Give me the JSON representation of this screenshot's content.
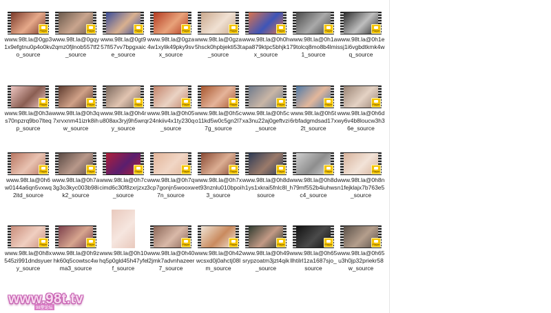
{
  "files": [
    {
      "name": "www.98t.la@0gp31x9efgtnu0p4o0kvo_source",
      "colors": [
        "#7a3a2a",
        "#e6a98a"
      ]
    },
    {
      "name": "www.98t.la@0gqy2qmz0fjlnob557tf2_source",
      "colors": [
        "#6b5a4d",
        "#c9a58e"
      ]
    },
    {
      "name": "www.98t.la@0gt957fi57vv7bpgxaice_source",
      "colors": [
        "#3a4d9a",
        "#d9b08f"
      ]
    },
    {
      "name": "www.98t.la@0gza4w1xylik49pky9svx_source",
      "colors": [
        "#b43b21",
        "#e8a27a"
      ]
    },
    {
      "name": "www.98t.la@0gza5hsck0hpbjekti53t_source",
      "colors": [
        "#caa98e",
        "#f0e1d3"
      ]
    },
    {
      "name": "www.98t.la@0h0hapa879ktpc5bhjk1x_source",
      "colors": [
        "#d9734e",
        "#3e55b8"
      ]
    },
    {
      "name": "www.98t.la@0h1a79tolcq8mo8b4lmi1_source",
      "colors": [
        "#4b4b4b",
        "#a9a9a9"
      ]
    },
    {
      "name": "www.98t.la@0h1essj1i6vgbdtkmk4wq_source",
      "colors": [
        "#2e2e2e",
        "#bfbfbf"
      ]
    },
    {
      "name": "www.98t.la@0h3as70npzrq9bo7lteqp_source",
      "colors": [
        "#eec6c2",
        "#8a5e52"
      ]
    },
    {
      "name": "www.98t.la@0h3q7xrvxnm41izrk8ihw_source",
      "colors": [
        "#5d3b2f",
        "#d0a188"
      ]
    },
    {
      "name": "www.98t.la@0h4ru808ax3ryj9h5wrqy_source",
      "colors": [
        "#7c6a5e",
        "#e1c4b1"
      ]
    },
    {
      "name": "www.98t.la@0h05r24nkiiv4x1ty230q_source",
      "colors": [
        "#c3856c",
        "#ead3c4"
      ]
    },
    {
      "name": "www.98t.la@0h5co11kd5w0c5gn2l77g_source",
      "colors": [
        "#a8572f",
        "#e5b49a"
      ]
    },
    {
      "name": "www.98t.la@0h5cxa3nu22aj0geftvzi_source",
      "colors": [
        "#6f7a8c",
        "#c9b6a6"
      ]
    },
    {
      "name": "www.98t.la@0h5t6rbfadgmdsad17x2t_source",
      "colors": [
        "#4f7aa8",
        "#e3b79b"
      ]
    },
    {
      "name": "www.98t.la@0h6dwy6v4b8loucw3h36e_source",
      "colors": [
        "#9b8576",
        "#e4d2c4"
      ]
    },
    {
      "name": "www.98t.la@0h6w0144a6qn5vxwq2itd_source",
      "colors": [
        "#b87763",
        "#e9c3b2"
      ]
    },
    {
      "name": "www.98t.la@0h7a3g3o3kyc003b98ik2_source",
      "colors": [
        "#5a4a44",
        "#b8988a"
      ]
    },
    {
      "name": "www.98t.la@0h7ccimd6c30f8zxrjzxz_source",
      "colors": [
        "#b01f3a",
        "#5a1e6e"
      ]
    },
    {
      "name": "www.98t.la@0h7q3cp7gonjn5wooxw7n_source",
      "colors": [
        "#e2b59a",
        "#f1d6c5"
      ]
    },
    {
      "name": "www.98t.la@0h7xet93nznlu010bpoi3_source",
      "colors": [
        "#8a4b35",
        "#dcae93"
      ]
    },
    {
      "name": "www.98t.la@0h8dh1ys1xkrai5fnlc8l_source",
      "colors": [
        "#2e3b55",
        "#9a7a6a"
      ]
    },
    {
      "name": "www.98t.la@0h8dh79mf552b4iuhwsc4_source",
      "colors": [
        "#cfcfcf",
        "#8e8e8e"
      ]
    },
    {
      "name": "www.98t.la@0h8nn1fejklajx7b763e5_source",
      "colors": [
        "#d7b39c",
        "#f2e3d8"
      ]
    },
    {
      "name": "www.98t.la@0h8x545zi991dndsyuery_source",
      "colors": [
        "#c98e7c",
        "#f0cfc1"
      ]
    },
    {
      "name": "www.98t.la@0h9zhk60q5cowtsc4wma3_source",
      "colors": [
        "#7b3f4b",
        "#d7a58f"
      ]
    },
    {
      "name": "www.98t.la@0h10hq5p0gld45h47yfef_source",
      "colors": [
        "#e9c9bd",
        "#f6e6df"
      ]
    },
    {
      "name": "www.98t.la@0h40l2jmk7advnhazeer7_source",
      "colors": [
        "#8c6758",
        "#d9b9a8"
      ]
    },
    {
      "name": "www.98t.la@0h42wcsxd0j0ahctj08lm_source",
      "colors": [
        "#f0e4d6",
        "#c98a5e"
      ]
    },
    {
      "name": "www.98t.la@0h49srypzoatm3jzt4qik_source",
      "colors": [
        "#2e3a2f",
        "#c39a86"
      ]
    },
    {
      "name": "www.98t.la@0h65llhtilrl1za1687sjo_source",
      "colors": [
        "#111111",
        "#4a4a4a"
      ]
    },
    {
      "name": "www.98t.la@0h65u3h0jp32priekr58w_source",
      "colors": [
        "#5b5149",
        "#b49e8c"
      ]
    }
  ],
  "badge_label": "Player",
  "watermark": {
    "text": "www.98t.tv",
    "subtext": "98堂论坛"
  }
}
